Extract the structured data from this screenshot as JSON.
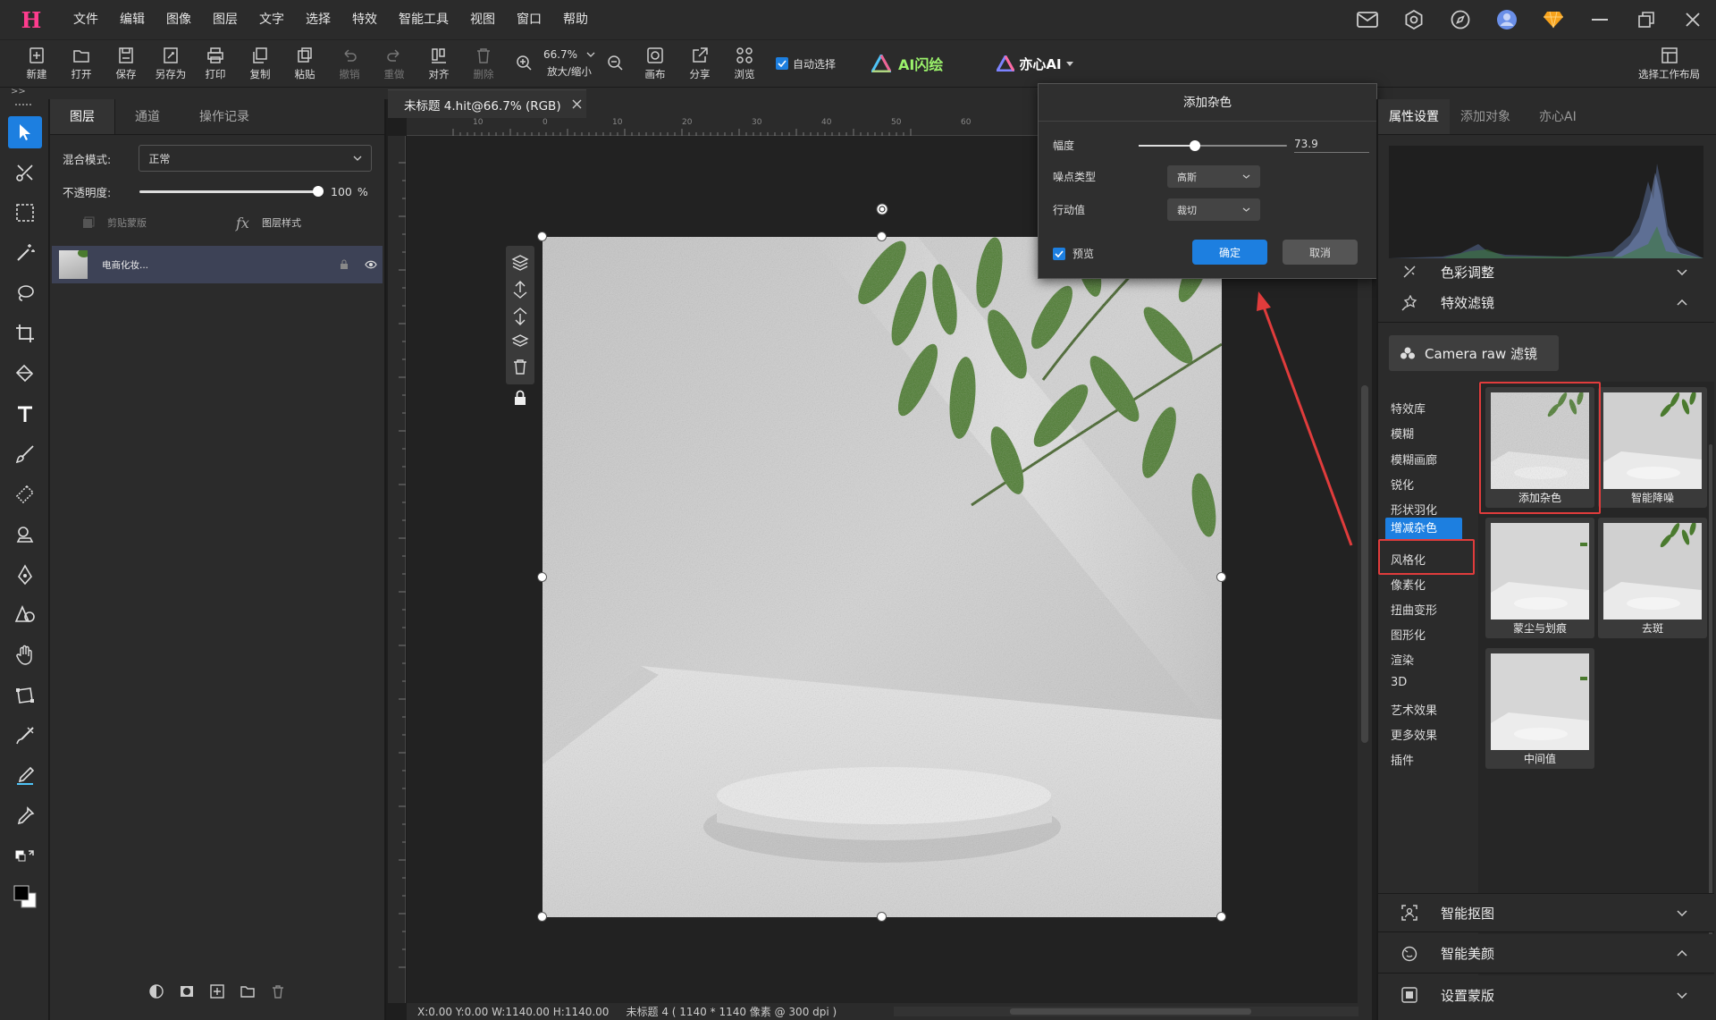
{
  "app": {
    "logo": "H",
    "menu": [
      "文件",
      "编辑",
      "图像",
      "图层",
      "文字",
      "选择",
      "特效",
      "智能工具",
      "视图",
      "窗口",
      "帮助"
    ]
  },
  "toolbar": {
    "new": "新建",
    "open": "打开",
    "save": "保存",
    "save_as": "另存为",
    "print": "打印",
    "copy": "复制",
    "paste": "粘贴",
    "undo": "撤销",
    "redo": "重做",
    "align": "对齐",
    "delete": "删除",
    "zoom_value": "66.7%",
    "zoom_label": "放大/缩小",
    "canvas": "画布",
    "share": "分享",
    "browse": "浏览",
    "auto_select": "自动选择",
    "ai_flash": "AI闪绘",
    "yixin_ai": "亦心AI",
    "layout": "选择工作布局"
  },
  "strip": {
    "expand": ">>"
  },
  "layers_panel": {
    "tabs": [
      "图层",
      "通道",
      "操作记录"
    ],
    "blend_label": "混合模式:",
    "blend_value": "正常",
    "opacity_label": "不透明度:",
    "opacity_value": "100",
    "opacity_unit": "%",
    "opacity_fraction": 1.0,
    "clipping_mask": "剪贴蒙版",
    "layer_style": "图层样式",
    "layer_name": "电商化妆..."
  },
  "document": {
    "tab_title": "未标题 4.hit@66.7% (RGB)",
    "ruler_labels": [
      "10",
      "0",
      "10",
      "20",
      "30",
      "40",
      "50",
      "60"
    ],
    "status": "X:0.00 Y:0.00 W:1140.00 H:1140.00     未标题 4 ( 1140 * 1140 像素 @ 300 dpi )"
  },
  "dialog": {
    "title": "添加杂色",
    "amount_label": "幅度",
    "amount_value": "73.9",
    "amount_fraction": 0.38,
    "noise_type_label": "噪点类型",
    "noise_type_value": "高斯",
    "action_label": "行动值",
    "action_value": "裁切",
    "preview_label": "预览",
    "preview_checked": true,
    "ok": "确定",
    "cancel": "取消"
  },
  "right_panel": {
    "tabs": [
      "属性设置",
      "添加对象",
      "亦心AI"
    ],
    "color_adjust": "色彩调整",
    "effects_filter": "特效滤镜",
    "camera_raw": "Camera raw 滤镜",
    "categories": [
      "特效库",
      "模糊",
      "模糊画廊",
      "锐化",
      "形状羽化",
      "增减杂色",
      "风格化",
      "像素化",
      "扭曲变形",
      "图形化",
      "渲染",
      "3D",
      "艺术效果",
      "更多效果",
      "插件"
    ],
    "selected_category": "增减杂色",
    "thumbnails": [
      "添加杂色",
      "智能降噪",
      "蒙尘与划痕",
      "去斑",
      "中间值"
    ],
    "smart_cutout": "智能抠图",
    "smart_beauty": "智能美颜",
    "set_mask": "设置蒙版"
  },
  "colors": {
    "accent": "#1d7fe0",
    "highlight": "#e03c3c",
    "panel": "#2b2b2b",
    "leaf": "#4a7a2e"
  }
}
